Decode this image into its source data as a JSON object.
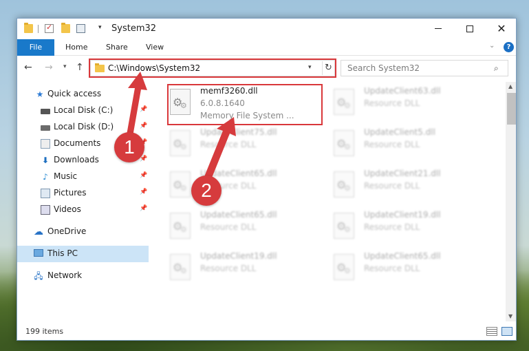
{
  "window": {
    "title": "System32"
  },
  "ribbon": {
    "tabs": [
      "File",
      "Home",
      "Share",
      "View"
    ],
    "help": "?"
  },
  "address": {
    "path": "C:\\Windows\\System32",
    "search_placeholder": "Search System32"
  },
  "sidebar": {
    "items": [
      {
        "label": "Quick access",
        "icon": "star-icon"
      },
      {
        "label": "Local Disk (C:)",
        "icon": "disk-icon",
        "pinned": true
      },
      {
        "label": "Local Disk (D:)",
        "icon": "disk-icon",
        "pinned": true
      },
      {
        "label": "Documents",
        "icon": "documents-icon",
        "pinned": true
      },
      {
        "label": "Downloads",
        "icon": "download-icon",
        "pinned": true
      },
      {
        "label": "Music",
        "icon": "music-icon",
        "pinned": true
      },
      {
        "label": "Pictures",
        "icon": "pictures-icon",
        "pinned": true
      },
      {
        "label": "Videos",
        "icon": "videos-icon",
        "pinned": true
      },
      {
        "label": "OneDrive",
        "icon": "cloud-icon"
      },
      {
        "label": "This PC",
        "icon": "computer-icon",
        "selected": true
      },
      {
        "label": "Network",
        "icon": "network-icon"
      }
    ]
  },
  "files": {
    "highlighted": {
      "name": "memf3260.dll",
      "version": "6.0.8.1640",
      "description": "Memory File System ..."
    },
    "blurred": [
      {
        "name": "UpdateClient63.dll",
        "type": "Resource DLL"
      },
      {
        "name": "UpdateClient5.dll",
        "type": "Resource DLL"
      },
      {
        "name": "UpdateClient75.dll",
        "type": "Resource DLL"
      },
      {
        "name": "UpdateClient21.dll",
        "type": "Resource DLL"
      },
      {
        "name": "UpdateClient65.dll",
        "type": "Resource DLL"
      },
      {
        "name": "UpdateClient19.dll",
        "type": "Resource DLL"
      },
      {
        "name": "UpdateClient65.dll",
        "type": "Resource DLL"
      },
      {
        "name": "UpdateClient19.dll",
        "type": "Resource DLL"
      },
      {
        "name": "UpdateClient65.dll",
        "type": "Resource DLL"
      }
    ]
  },
  "status": {
    "count": "199 items"
  },
  "annotations": {
    "badge1": "1",
    "badge2": "2",
    "color": "#d63b3d"
  }
}
